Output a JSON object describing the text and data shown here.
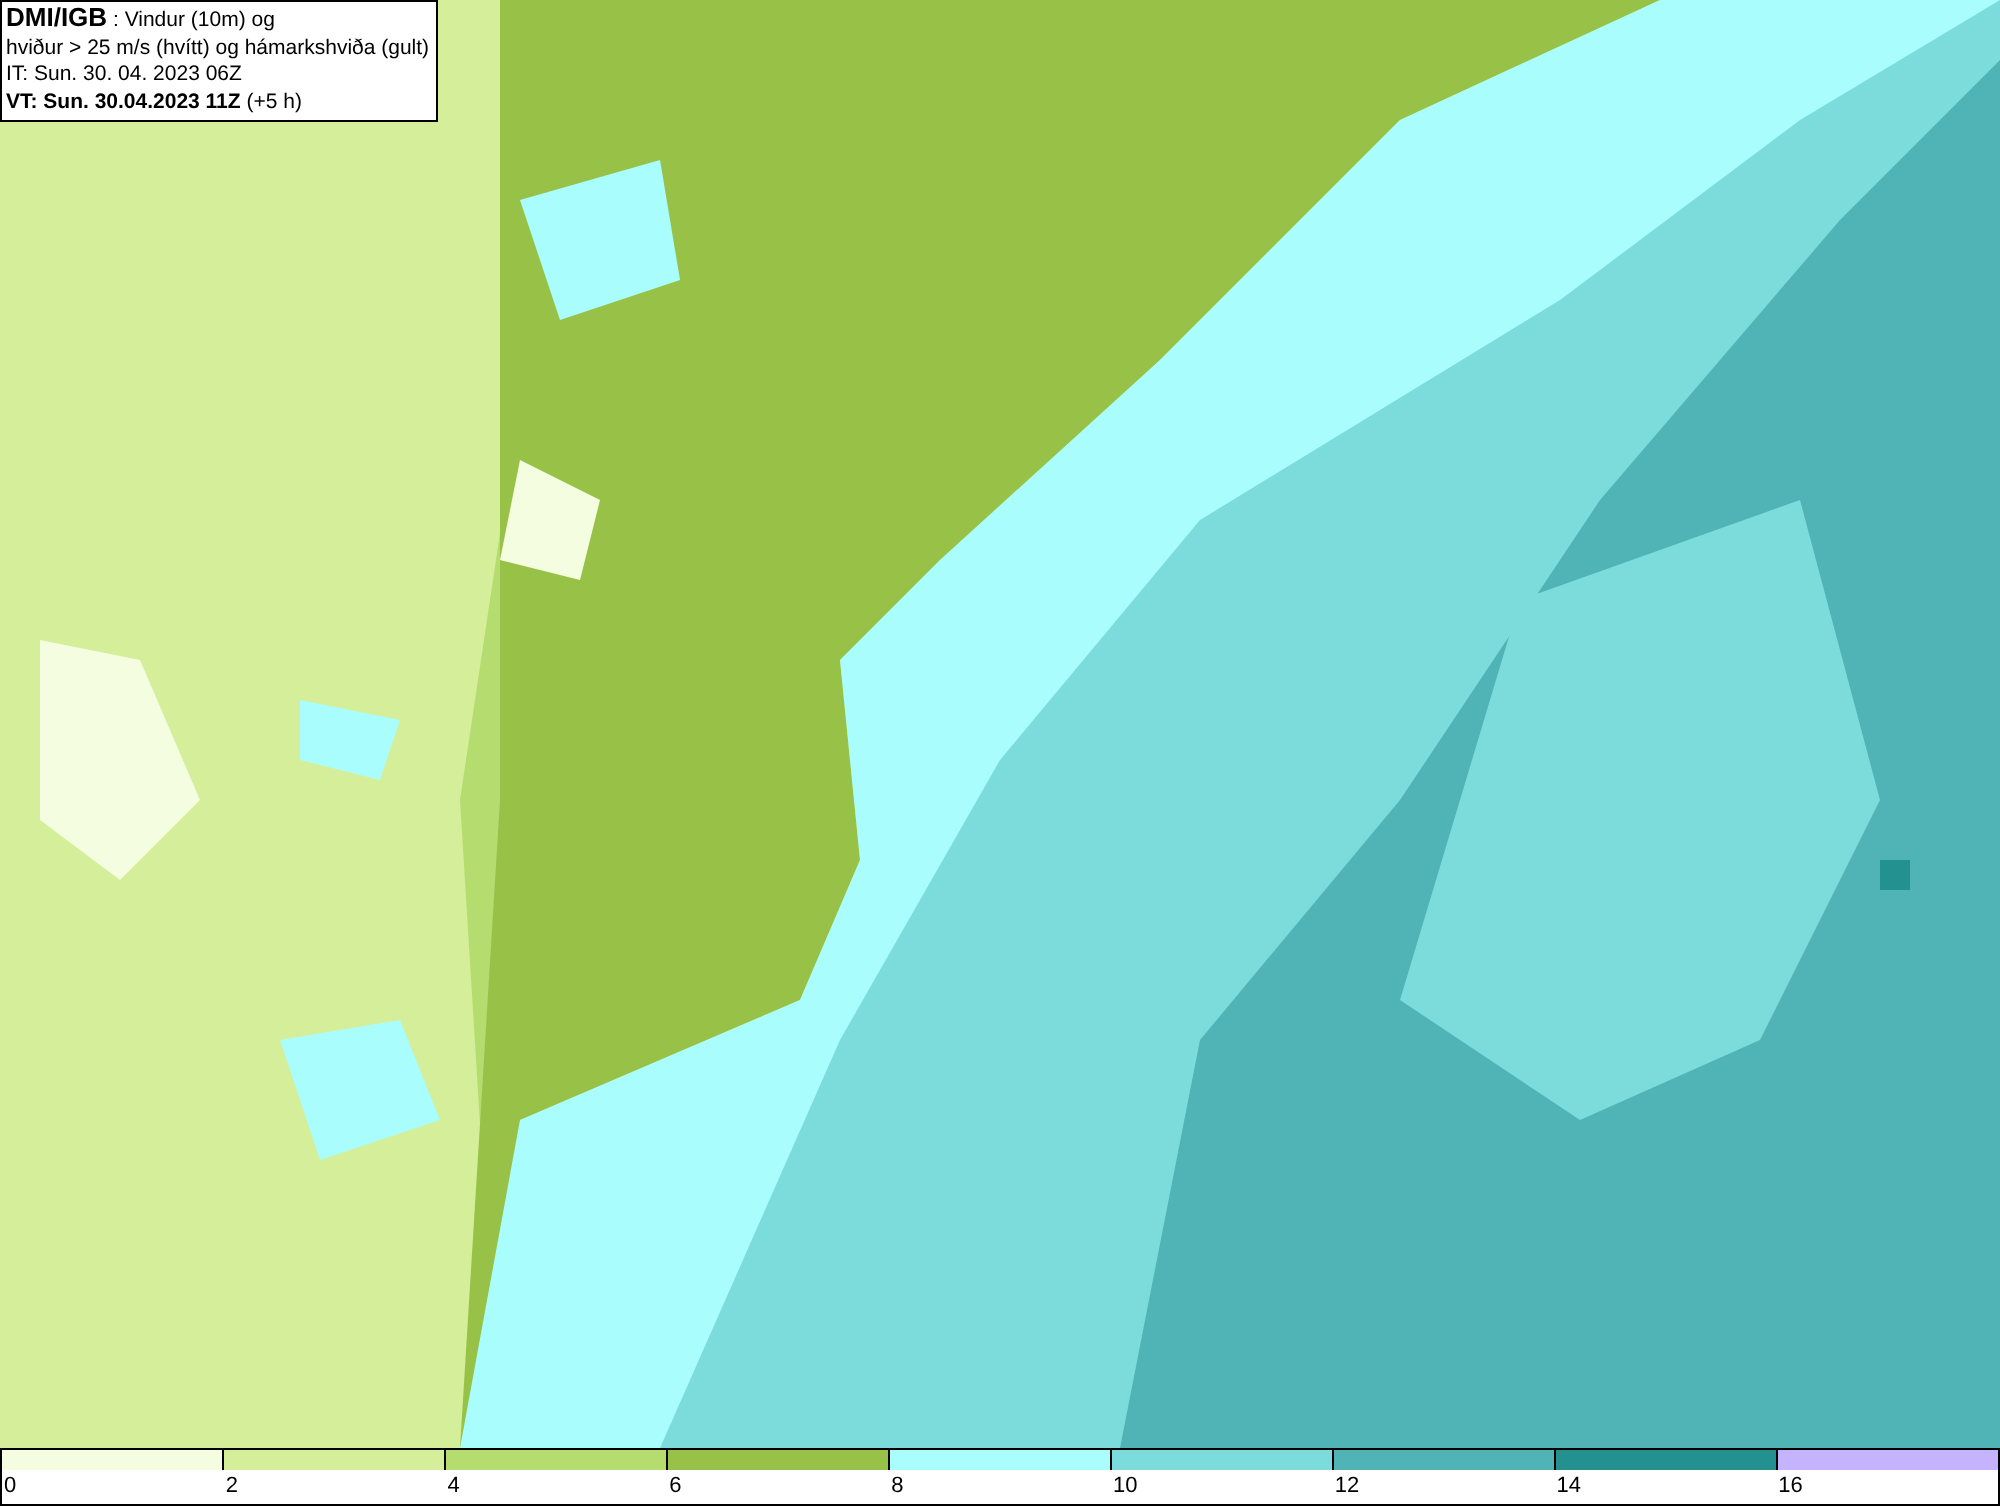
{
  "header": {
    "lines": [
      "**DMI/IGB** : Vindur (10m) og",
      "hviður > 25 m/s (hvítt) og hámarkshviða (gult)",
      "IT: Sun. 30. 04. 2023 06Z",
      "**VT: Sun. 30.04.2023 11Z** (+5 h)"
    ]
  },
  "legend": {
    "bins": [
      {
        "color": "#f5fde0"
      },
      {
        "color": "#d4ee9a"
      },
      {
        "color": "#b5dc6e"
      },
      {
        "color": "#98c247"
      },
      {
        "color": "#a9fdfd"
      },
      {
        "color": "#7cdcdc"
      },
      {
        "color": "#50b3b5"
      },
      {
        "color": "#22918f"
      },
      {
        "color": "#c5b4fd"
      }
    ],
    "ticks": [
      "0",
      "2",
      "4",
      "6",
      "8",
      "10",
      "12",
      "14",
      "16"
    ]
  }
}
